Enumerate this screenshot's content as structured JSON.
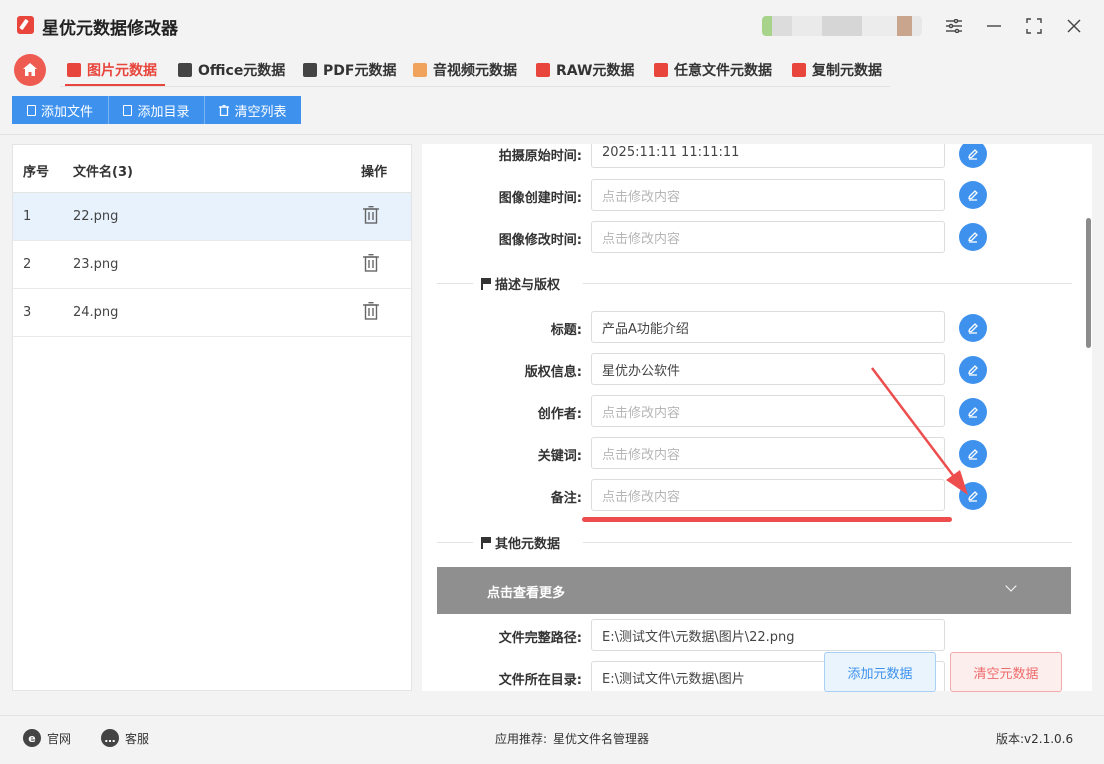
{
  "app": {
    "title": "星优元数据修改器"
  },
  "tabs": [
    {
      "label": "图片元数据",
      "active": true,
      "icon": "image-tab-icon",
      "color": "#e8453c"
    },
    {
      "label": "Office元数据",
      "icon": "office-tab-icon",
      "color": "#444444"
    },
    {
      "label": "PDF元数据",
      "icon": "pdf-tab-icon",
      "color": "#444444"
    },
    {
      "label": "音视频元数据",
      "icon": "media-tab-icon",
      "color": "#e8453c"
    },
    {
      "label": "RAW元数据",
      "icon": "raw-tab-icon",
      "color": "#e8453c"
    },
    {
      "label": "任意文件元数据",
      "icon": "file-tab-icon",
      "color": "#e8453c"
    },
    {
      "label": "复制元数据",
      "icon": "copy-tab-icon",
      "color": "#e8453c"
    }
  ],
  "toolbar": {
    "add_file": "添加文件",
    "add_dir": "添加目录",
    "clear_list": "清空列表"
  },
  "file_table": {
    "columns": [
      "序号",
      "文件名(3)",
      "操作"
    ],
    "rows": [
      {
        "index": "1",
        "name": "22.png",
        "selected": true
      },
      {
        "index": "2",
        "name": "23.png"
      },
      {
        "index": "3",
        "name": "24.png"
      }
    ]
  },
  "placeholder": "点击修改内容",
  "fields_time": [
    {
      "label": "拍摄原始时间:",
      "value": "2025:11:11 11:11:11"
    },
    {
      "label": "图像创建时间:",
      "value": ""
    },
    {
      "label": "图像修改时间:",
      "value": ""
    }
  ],
  "section_desc": "描述与版权",
  "fields_desc": [
    {
      "label": "标题:",
      "value": "产品A功能介绍"
    },
    {
      "label": "版权信息:",
      "value": "星优办公软件"
    },
    {
      "label": "创作者:",
      "value": ""
    },
    {
      "label": "关键词:",
      "value": ""
    },
    {
      "label": "备注:",
      "value": ""
    }
  ],
  "section_other": "其他元数据",
  "more_label": "点击查看更多",
  "fields_path": [
    {
      "label": "文件完整路径:",
      "value": "E:\\测试文件\\元数据\\图片\\22.png"
    },
    {
      "label": "文件所在目录:",
      "value": "E:\\测试文件\\元数据\\图片"
    }
  ],
  "actions": {
    "add_meta": "添加元数据",
    "clear_meta": "清空元数据"
  },
  "footer": {
    "website": "官网",
    "service": "客服",
    "recommend_prefix": "应用推荐:",
    "recommend_app": "星优文件名管理器",
    "version": "版本:v2.1.0.6"
  },
  "colors": {
    "accent": "#3e92ee",
    "brand_red": "#e8453c",
    "annotation_red": "#ee4d4d"
  }
}
